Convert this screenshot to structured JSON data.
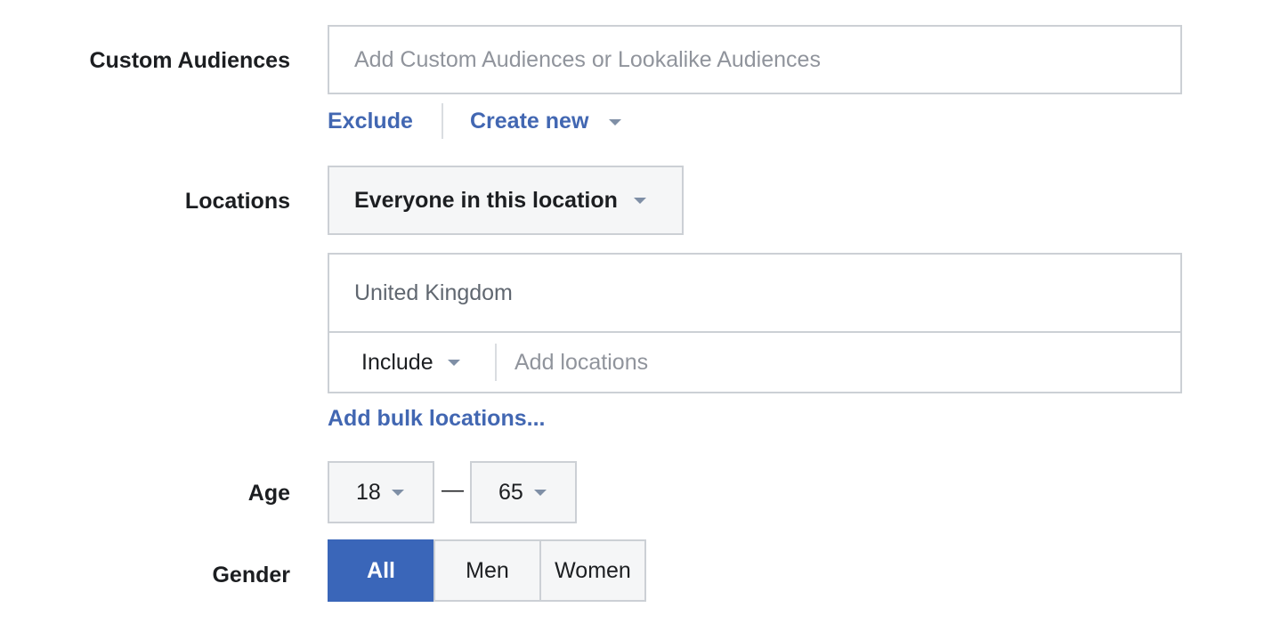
{
  "custom_audiences": {
    "label": "Custom Audiences",
    "placeholder": "Add Custom Audiences or Lookalike Audiences",
    "exclude_label": "Exclude",
    "create_new_label": "Create new"
  },
  "locations": {
    "label": "Locations",
    "scope_dropdown": "Everyone in this location",
    "selected": [
      "United Kingdom"
    ],
    "mode_dropdown": "Include",
    "add_placeholder": "Add locations",
    "bulk_link": "Add bulk locations..."
  },
  "age": {
    "label": "Age",
    "min": "18",
    "separator": "—",
    "max": "65"
  },
  "gender": {
    "label": "Gender",
    "options": [
      "All",
      "Men",
      "Women"
    ],
    "selected": "All"
  },
  "colors": {
    "link": "#4267b2",
    "active_segment": "#3a66b9",
    "border": "#ccd0d5"
  }
}
